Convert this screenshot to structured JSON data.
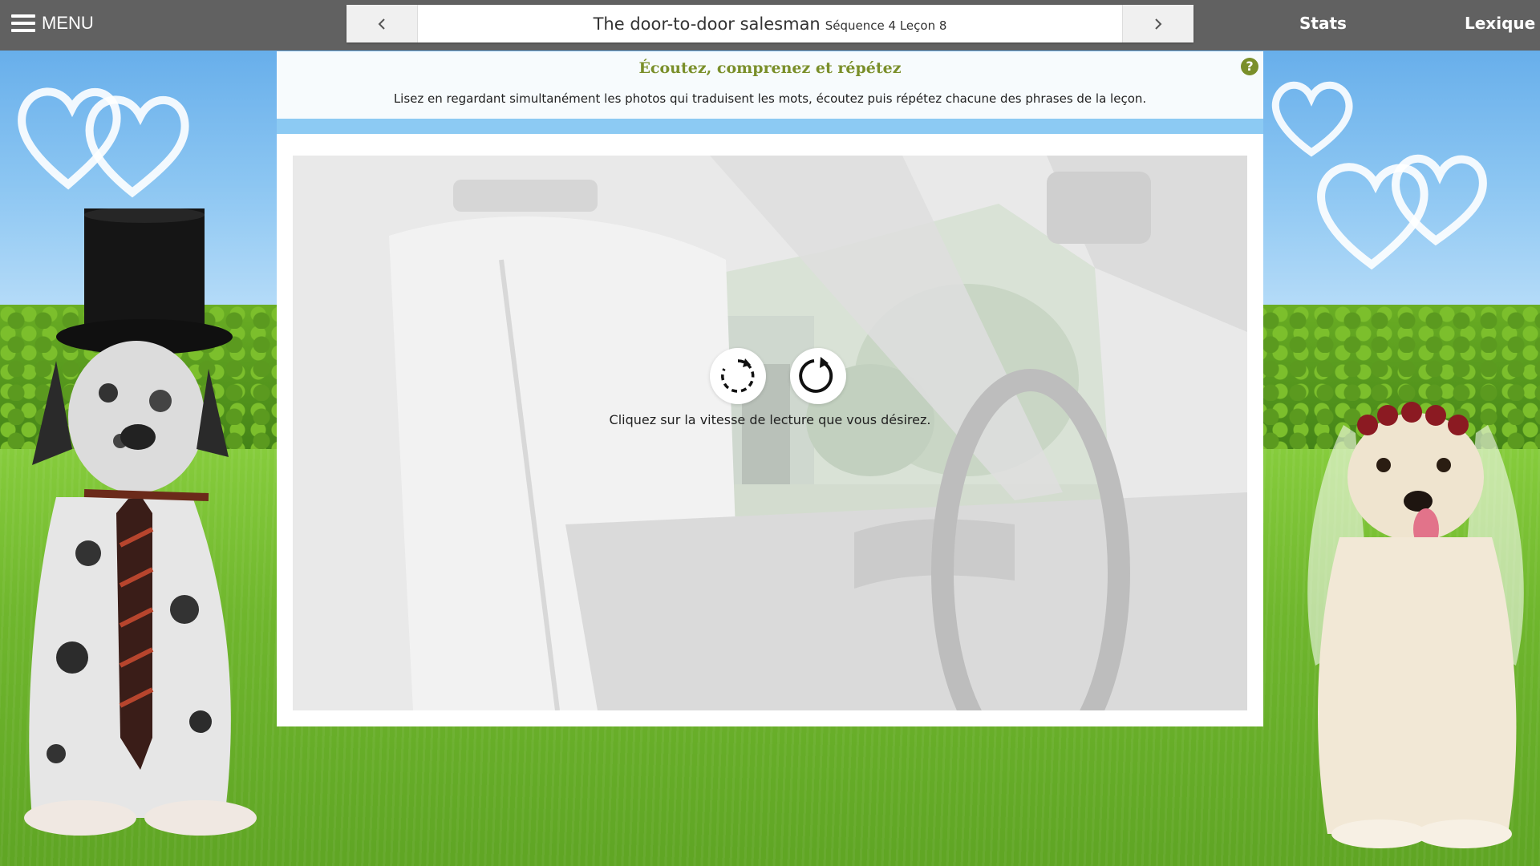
{
  "topbar": {
    "menu_label": "MENU",
    "lesson_title": "The door-to-door salesman",
    "lesson_subtitle": "Séquence 4 Leçon 8",
    "stats_label": "Stats",
    "lexique_label": "Lexique"
  },
  "instructions": {
    "title": "Écoutez, comprenez et répétez",
    "text": "Lisez en regardant simultanément les photos qui traduisent les mots, écoutez puis répétez chacune des phrases de la leçon.",
    "help_symbol": "?"
  },
  "player": {
    "prompt": "Cliquez sur la vitesse de lecture que vous désirez.",
    "speed_options": [
      "slow-replay-icon",
      "normal-replay-icon"
    ]
  },
  "colors": {
    "topbar": "#616161",
    "accent_green": "#7a8f2a",
    "strip_blue": "#8ccaf3"
  }
}
